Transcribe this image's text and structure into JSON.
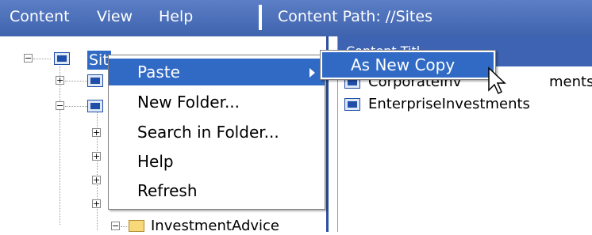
{
  "menubar": {
    "items": [
      "Content",
      "View",
      "Help"
    ],
    "content_path": "Content Path: //Sites"
  },
  "tree": {
    "root_label": "Sit",
    "partial_bottom_label": "InvestmentAdvice"
  },
  "right": {
    "header_label": "Content Titl",
    "items": [
      "CorporateInvestments",
      "EnterpriseInvestments"
    ],
    "item0_visible": "CorporateInv",
    "item0_tail": "ments"
  },
  "context_menu": {
    "items": [
      "Paste",
      "New Folder...",
      "Search in Folder...",
      "Help",
      "Refresh"
    ],
    "active_index": 0
  },
  "submenu": {
    "items": [
      "As New Copy"
    ]
  },
  "icons": {
    "site": "site-icon",
    "folder": "folder-icon",
    "expand": "expand-icon",
    "cursor": "mouse-cursor-icon"
  },
  "colors": {
    "menubar": "#4a6fb8",
    "selection": "#316ac5"
  }
}
